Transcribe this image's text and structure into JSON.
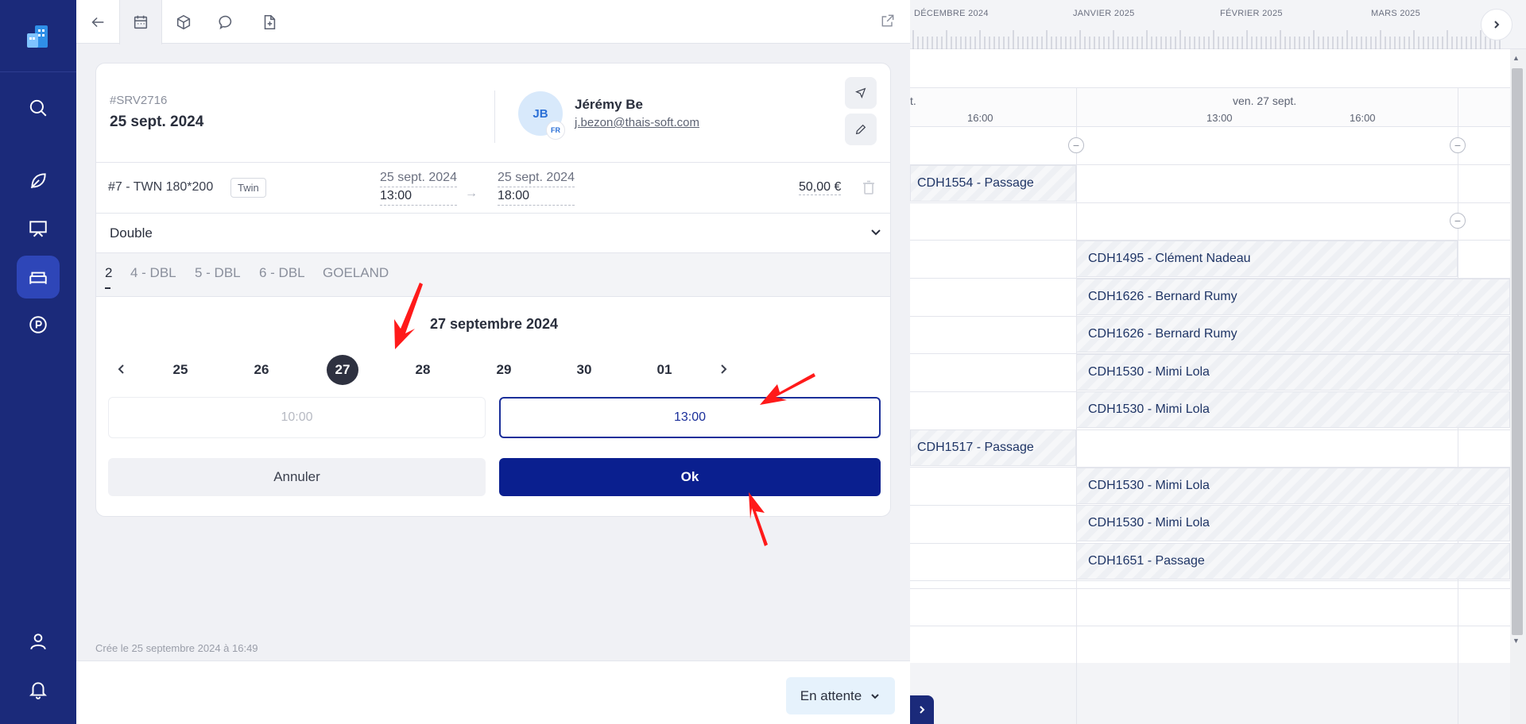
{
  "booking": {
    "ref": "#SRV2716",
    "date": "25 sept. 2024",
    "guest_initials": "JB",
    "guest_flag": "FR",
    "guest_name": "Jérémy Be",
    "guest_email": "j.bezon@thais-soft.com"
  },
  "room": {
    "name": "#7 - TWN 180*200",
    "tag": "Twin",
    "start_date": "25 sept. 2024",
    "start_time": "13:00",
    "end_date": "25 sept. 2024",
    "end_time": "18:00",
    "price": "50,00 €"
  },
  "room_type": "Double",
  "room_tabs": [
    "2",
    "4 - DBL",
    "5 - DBL",
    "6 - DBL",
    "GOELAND"
  ],
  "calendar": {
    "title": "27 septembre 2024",
    "days": [
      "25",
      "26",
      "27",
      "28",
      "29",
      "30",
      "01"
    ],
    "selected_day": "27",
    "time_slots": [
      {
        "label": "10:00",
        "state": "disabled"
      },
      {
        "label": "13:00",
        "state": "selected"
      }
    ],
    "cancel_label": "Annuler",
    "ok_label": "Ok"
  },
  "created_text": "Crée le 25 septembre 2024 à 16:49",
  "status_label": "En attente",
  "timeline": {
    "months": [
      "DÉCEMBRE 2024",
      "JANVIER 2025",
      "FÉVRIER 2025",
      "MARS 2025"
    ]
  },
  "planning": {
    "prev_day_label": "t.",
    "day_label": "ven. 27 sept.",
    "hours": [
      "16:00",
      "13:00",
      "16:00"
    ],
    "reservations": [
      "CDH1554 - Passage",
      "CDH1495 - Clément Nadeau",
      "CDH1626 - Bernard Rumy",
      "CDH1626 - Bernard Rumy",
      "CDH1530 - Mimi Lola",
      "CDH1530 - Mimi Lola",
      "CDH1517 - Passage",
      "CDH1530 - Mimi Lola",
      "CDH1530 - Mimi Lola",
      "CDH1651 - Passage"
    ]
  },
  "colors": {
    "sidebar": "#1b2a7a",
    "primary": "#0a1f8f",
    "annotation": "#ff0000"
  }
}
